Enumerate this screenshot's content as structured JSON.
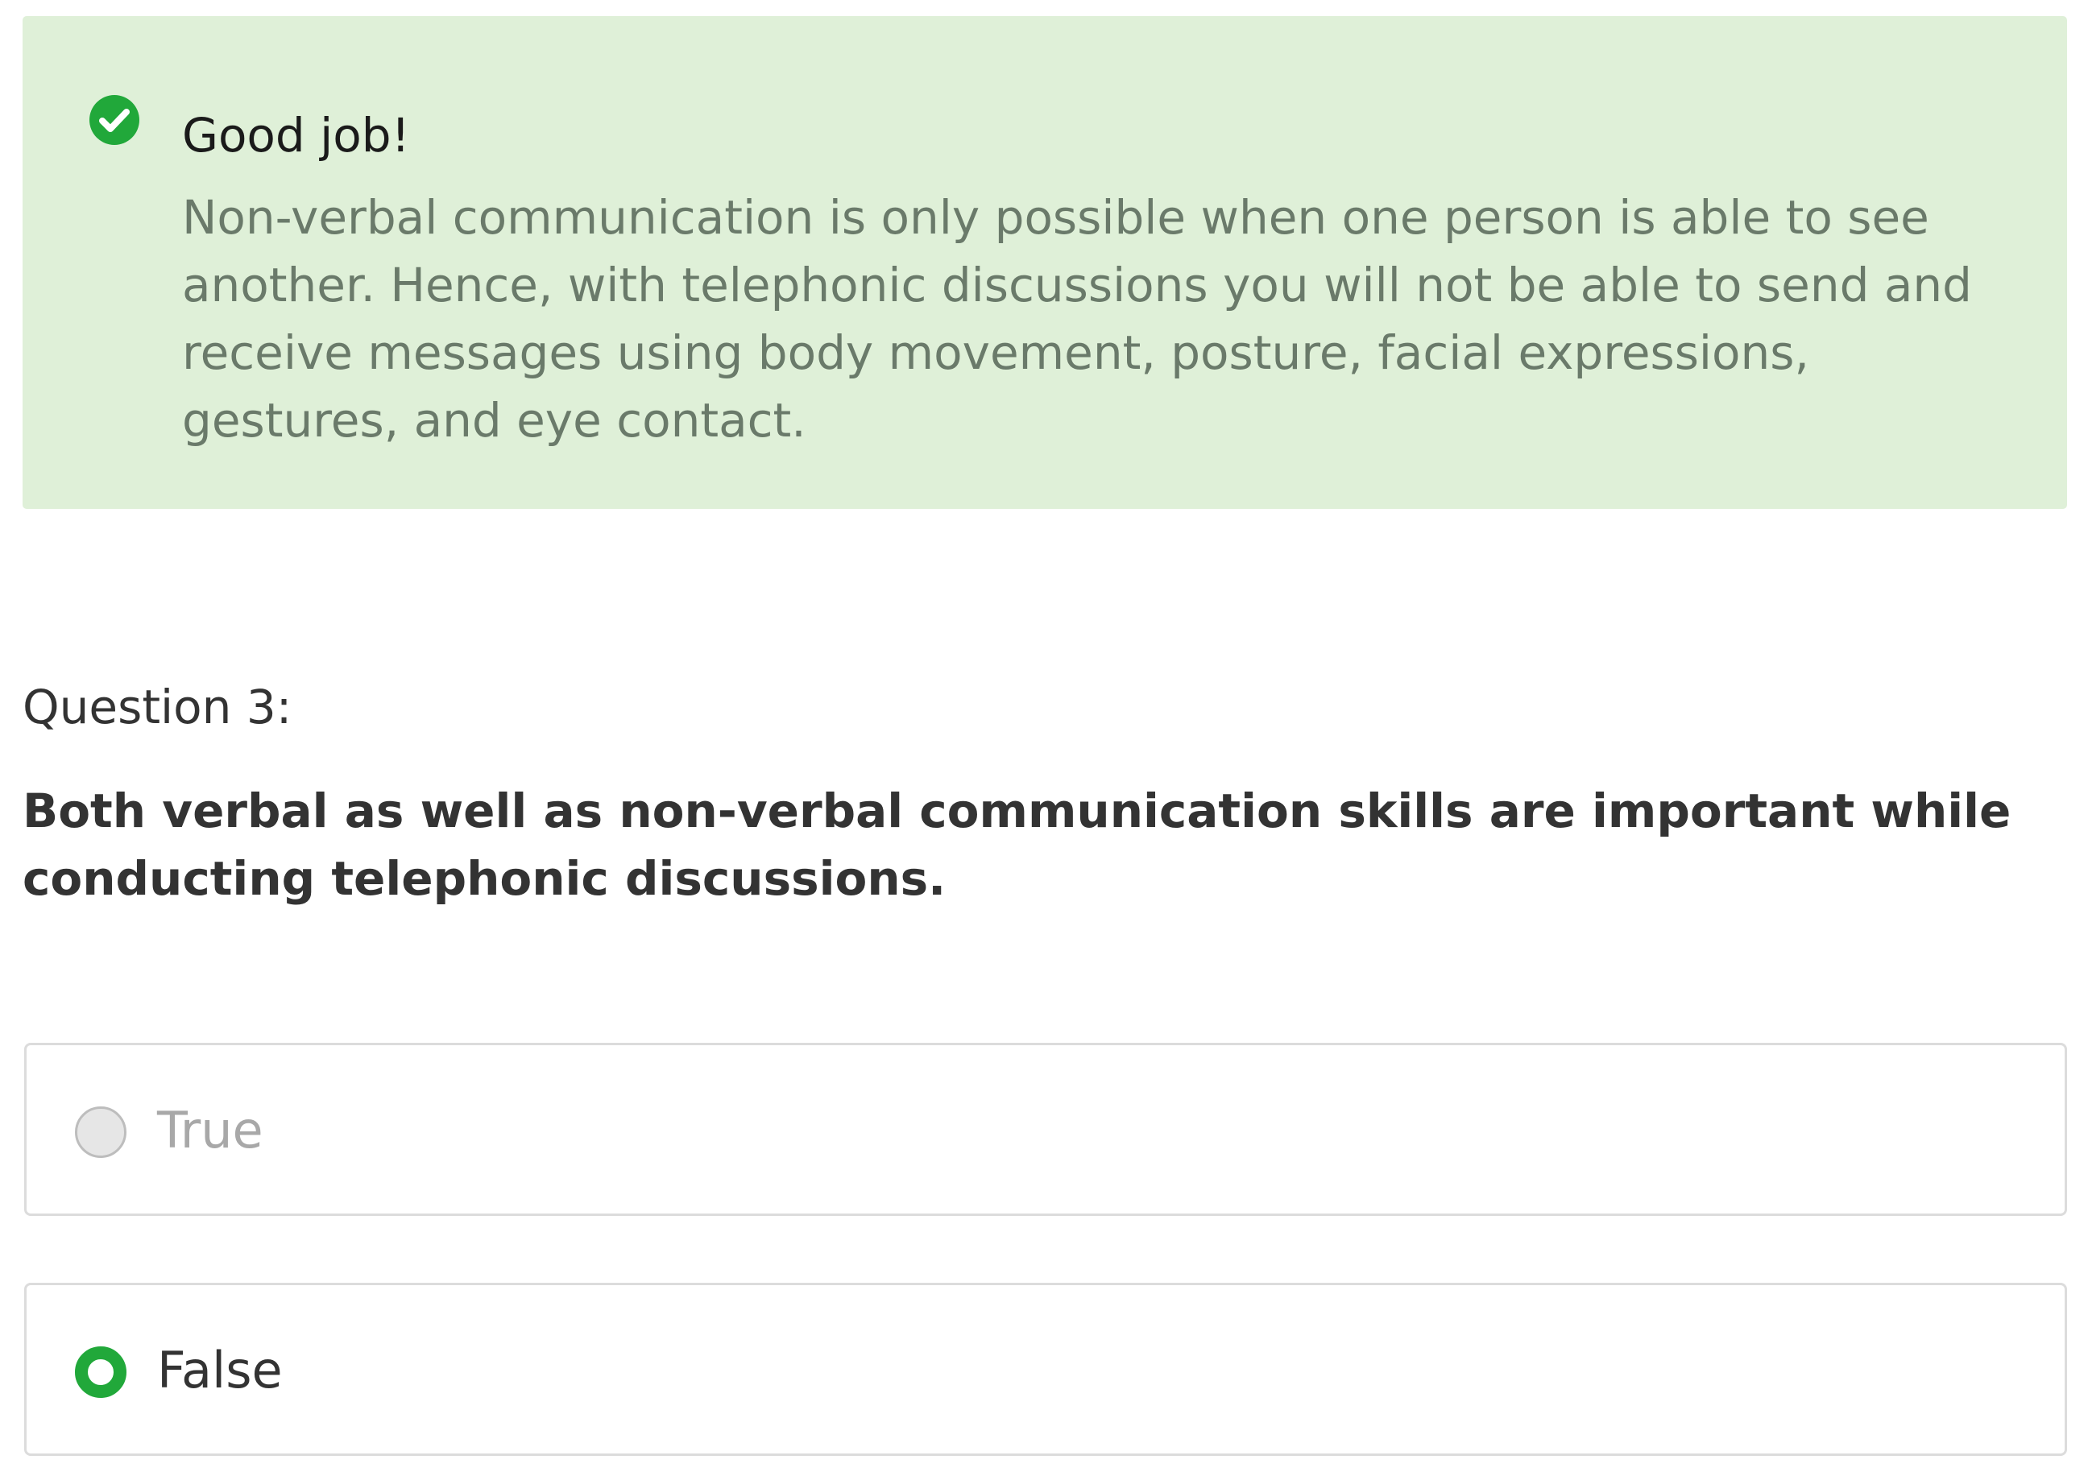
{
  "feedback": {
    "icon": "check-circle-icon",
    "title": "Good job!",
    "body": "Non-verbal communication is only possible when one person is able to see another. Hence, with telephonic discussions you will not be able to send and receive messages using body movement, posture, facial expressions, gestures, and eye contact.",
    "background_color": "#dff0d8",
    "icon_color": "#21a83a"
  },
  "question": {
    "number_label": "Question 3:",
    "text": "Both verbal as well as non-verbal communication skills are important while conducting telephonic discussions."
  },
  "options": [
    {
      "label": "True",
      "selected": false
    },
    {
      "label": "False",
      "selected": true
    }
  ],
  "colors": {
    "accent": "#21a83a"
  }
}
